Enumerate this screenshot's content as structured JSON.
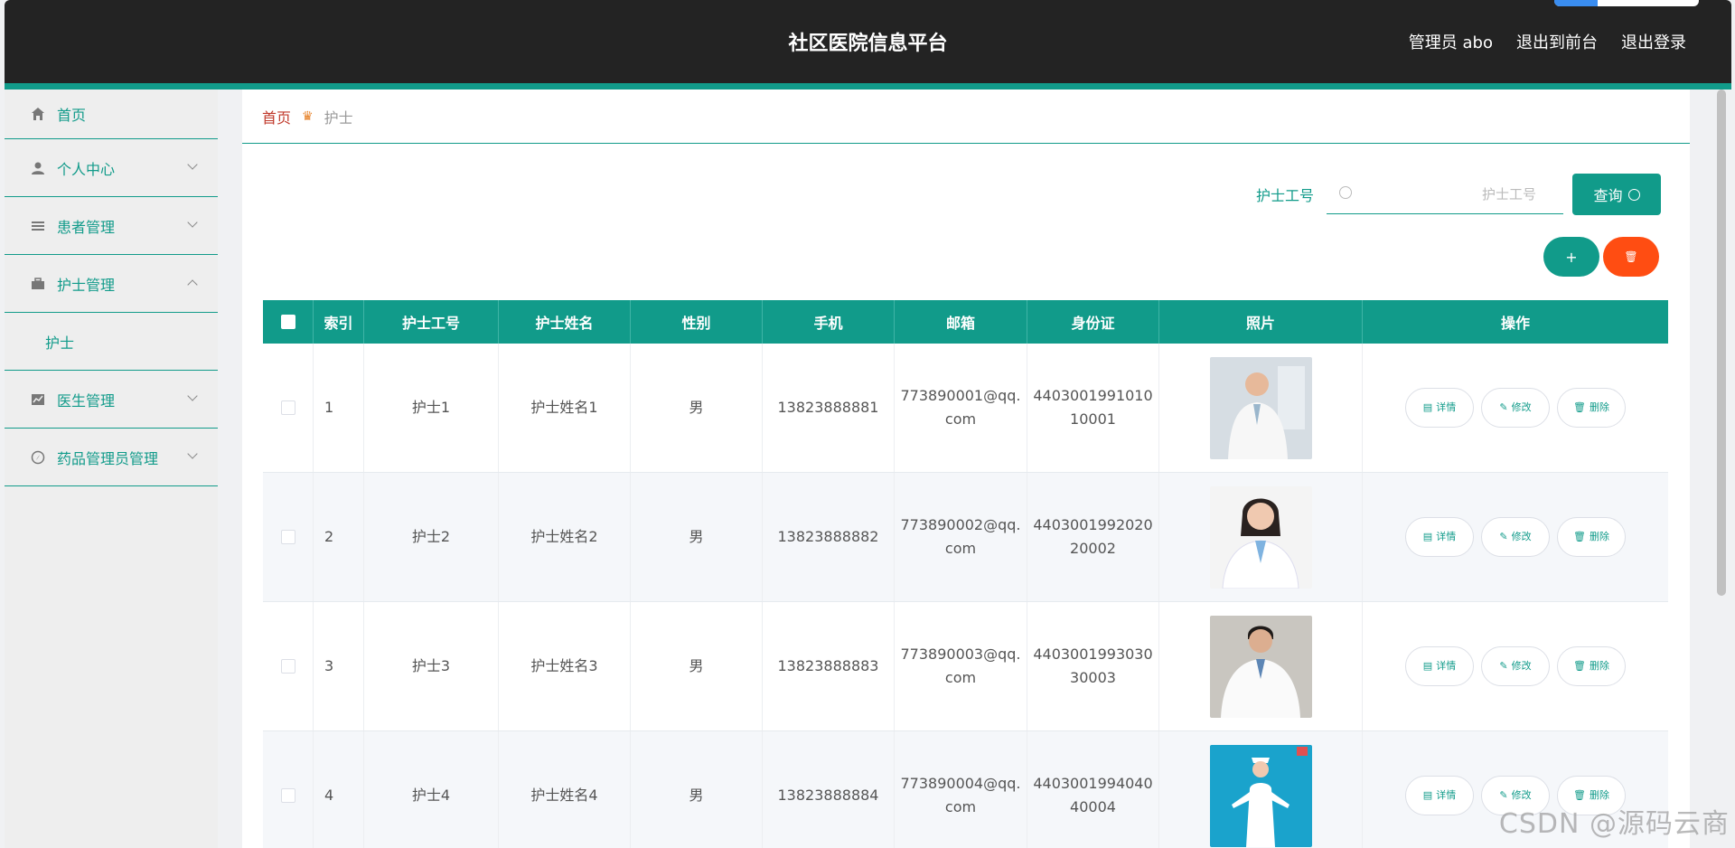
{
  "header": {
    "title": "社区医院信息平台",
    "admin": "管理员 abo",
    "front": "退出到前台",
    "logout": "退出登录"
  },
  "sidebar": {
    "items": [
      {
        "label": "首页",
        "icon": "home-icon"
      },
      {
        "label": "个人中心",
        "icon": "user-icon"
      },
      {
        "label": "患者管理",
        "icon": "list-icon"
      },
      {
        "label": "护士管理",
        "icon": "briefcase-icon"
      },
      {
        "label": "医生管理",
        "icon": "chart-icon"
      },
      {
        "label": "药品管理员管理",
        "icon": "compass-icon"
      }
    ],
    "sub_nurse": "护士"
  },
  "breadcrumb": {
    "home": "首页",
    "current": "护士"
  },
  "search": {
    "label": "护士工号",
    "placeholder": "护士工号",
    "button": "查询"
  },
  "actions": {
    "add": "+",
    "delete": "🗑"
  },
  "table": {
    "headers": [
      "索引",
      "护士工号",
      "护士姓名",
      "性别",
      "手机",
      "邮箱",
      "身份证",
      "照片",
      "操作"
    ],
    "ops": {
      "detail": "详情",
      "edit": "修改",
      "remove": "删除"
    },
    "rows": [
      {
        "index": "1",
        "no": "护士1",
        "name": "护士姓名1",
        "gender": "男",
        "phone": "13823888881",
        "email": "773890001@qq.com",
        "idcard": "440300199101010001"
      },
      {
        "index": "2",
        "no": "护士2",
        "name": "护士姓名2",
        "gender": "男",
        "phone": "13823888882",
        "email": "773890002@qq.com",
        "idcard": "440300199202020002"
      },
      {
        "index": "3",
        "no": "护士3",
        "name": "护士姓名3",
        "gender": "男",
        "phone": "13823888883",
        "email": "773890003@qq.com",
        "idcard": "440300199303030003"
      },
      {
        "index": "4",
        "no": "护士4",
        "name": "护士姓名4",
        "gender": "男",
        "phone": "13823888884",
        "email": "773890004@qq.com",
        "idcard": "440300199404040004"
      }
    ]
  },
  "watermark": "CSDN @源码云商",
  "colors": {
    "accent": "#119b8a",
    "danger": "#ff4d12",
    "header": "#232323"
  }
}
